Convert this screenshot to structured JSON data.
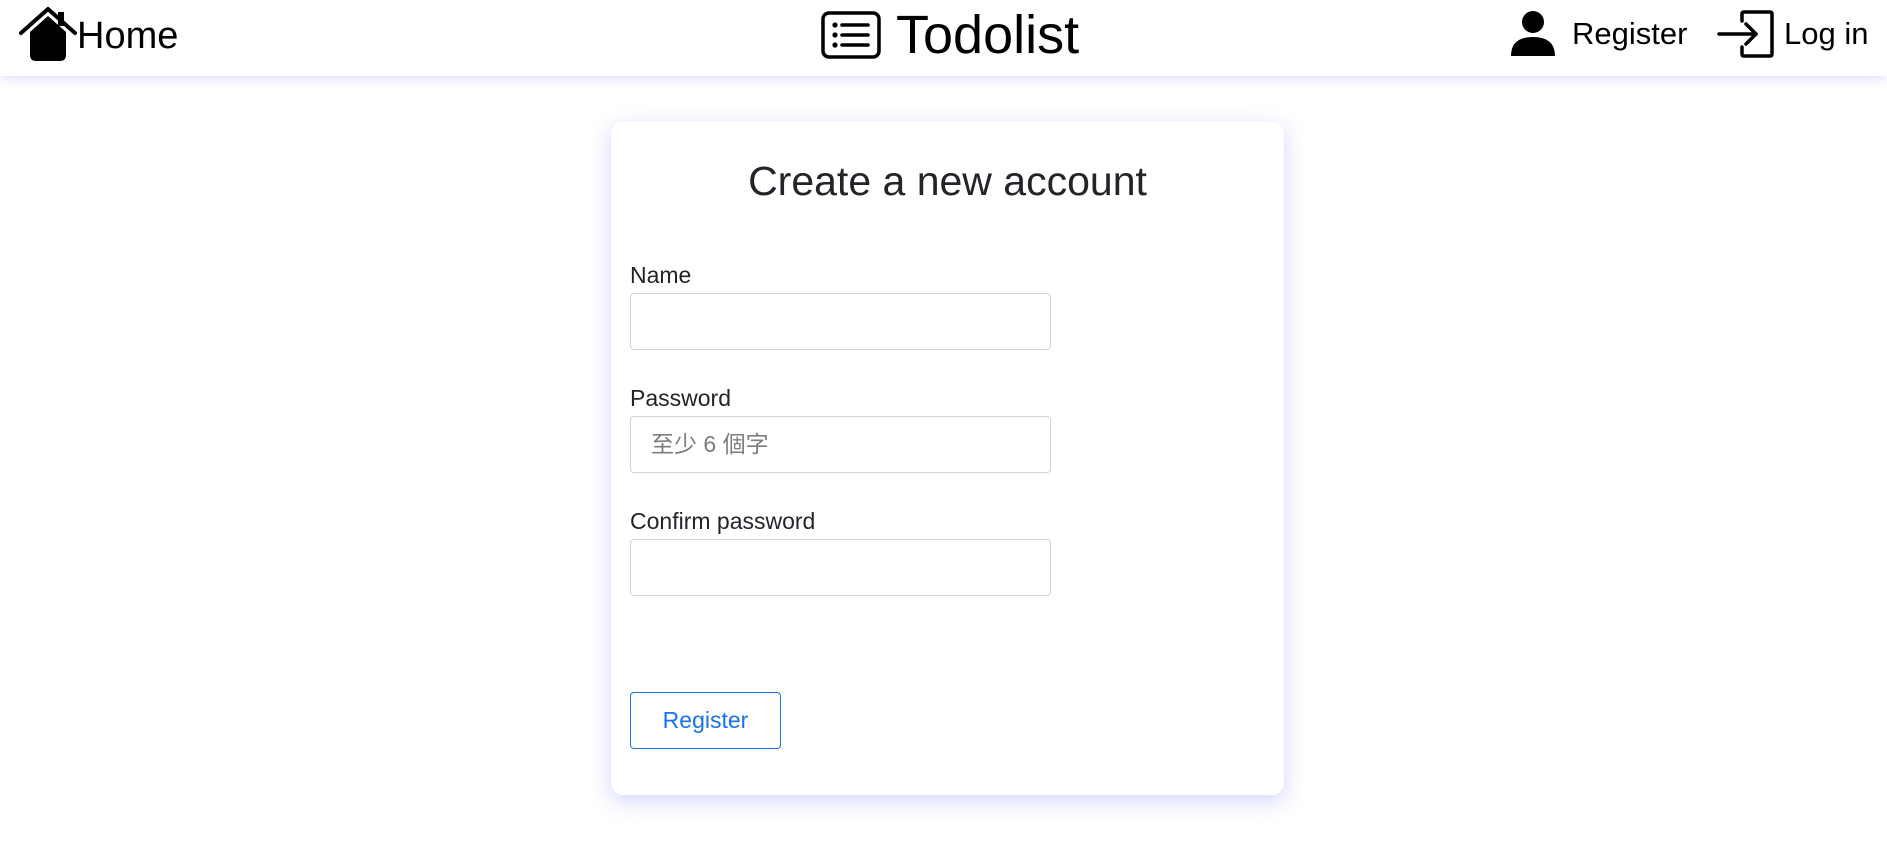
{
  "nav": {
    "home_label": "Home",
    "brand_label": "Todolist",
    "register_label": "Register",
    "login_label": "Log in"
  },
  "form": {
    "title": "Create a new account",
    "fields": [
      {
        "label": "Name",
        "value": "",
        "placeholder": ""
      },
      {
        "label": "Password",
        "value": "",
        "placeholder": "至少 6 個字"
      },
      {
        "label": "Confirm password",
        "value": "",
        "placeholder": ""
      }
    ],
    "submit_label": "Register"
  },
  "icons": {
    "home": "home-icon",
    "brand": "list-icon",
    "register": "person-icon",
    "login": "login-icon"
  },
  "colors": {
    "accent": "#1a73e8",
    "text": "#212529",
    "card_shadow": "#6e6eff"
  }
}
